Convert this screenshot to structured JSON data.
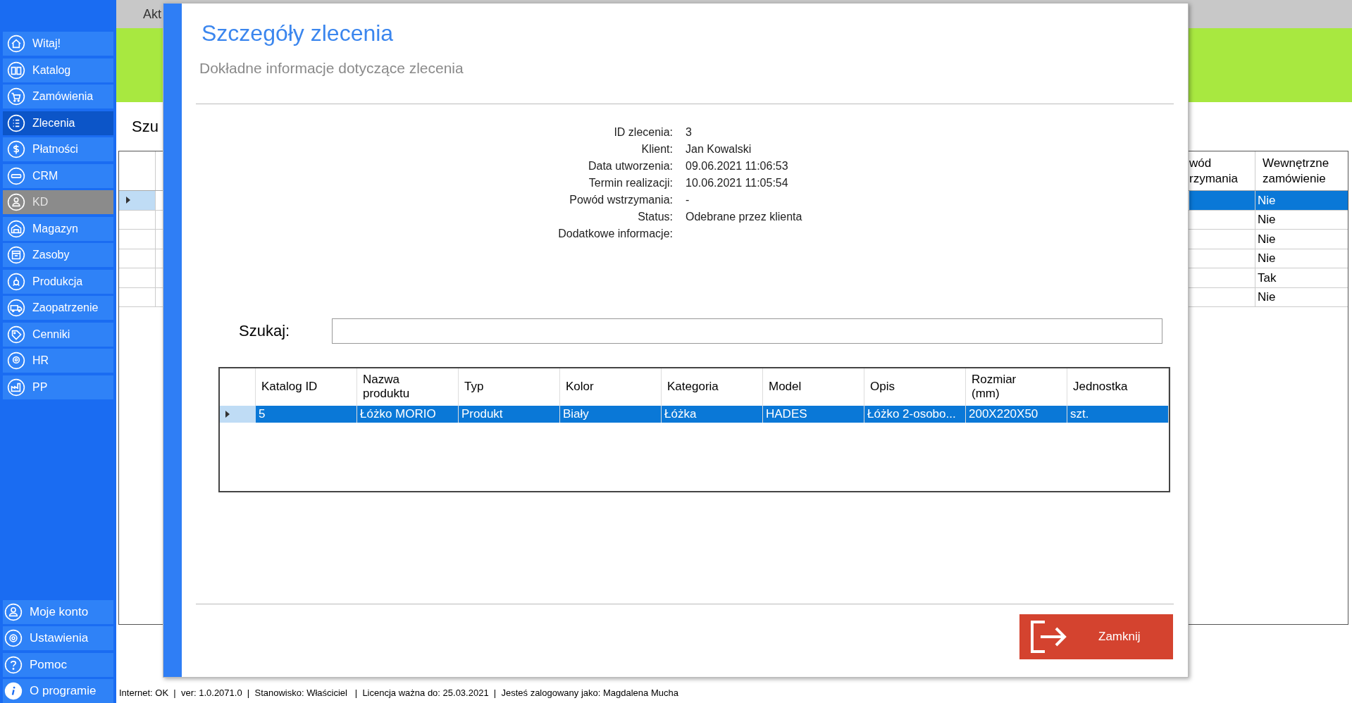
{
  "sidebar": {
    "items": [
      {
        "label": "Witaj!",
        "selected": false,
        "disabled": false
      },
      {
        "label": "Katalog",
        "selected": false,
        "disabled": false
      },
      {
        "label": "Zamówienia",
        "selected": false,
        "disabled": false
      },
      {
        "label": "Zlecenia",
        "selected": true,
        "disabled": false
      },
      {
        "label": "Płatności",
        "selected": false,
        "disabled": false
      },
      {
        "label": "CRM",
        "selected": false,
        "disabled": false
      },
      {
        "label": "KD",
        "selected": false,
        "disabled": true
      },
      {
        "label": "Magazyn",
        "selected": false,
        "disabled": false
      },
      {
        "label": "Zasoby",
        "selected": false,
        "disabled": false
      },
      {
        "label": "Produkcja",
        "selected": false,
        "disabled": false
      },
      {
        "label": "Zaopatrzenie",
        "selected": false,
        "disabled": false
      },
      {
        "label": "Cenniki",
        "selected": false,
        "disabled": false
      },
      {
        "label": "HR",
        "selected": false,
        "disabled": false
      },
      {
        "label": "PP",
        "selected": false,
        "disabled": false
      }
    ],
    "bottom_items": [
      {
        "label": "Moje konto"
      },
      {
        "label": "Ustawienia"
      },
      {
        "label": "Pomoc"
      },
      {
        "label": "O programie"
      }
    ]
  },
  "background": {
    "tab_label": "Akt",
    "search_label": "Szu",
    "table": {
      "columns": [
        "wód rzymania",
        "Wewnętrzne zamówienie"
      ],
      "rows": [
        {
          "last": "Nie",
          "selected": true
        },
        {
          "last": "Nie",
          "selected": false
        },
        {
          "last": "Nie",
          "selected": false
        },
        {
          "last": "Nie",
          "selected": false
        },
        {
          "last": "Tak",
          "selected": false
        },
        {
          "last": "Nie",
          "selected": false
        }
      ]
    }
  },
  "dialog": {
    "title": "Szczegóły zlecenia",
    "subtitle": "Dokładne informacje dotyczące zlecenia",
    "details": [
      {
        "label": "ID zlecenia:",
        "value": "3"
      },
      {
        "label": "Klient:",
        "value": "Jan Kowalski"
      },
      {
        "label": "Data utworzenia:",
        "value": "09.06.2021 11:06:53"
      },
      {
        "label": "Termin realizacji:",
        "value": "10.06.2021 11:05:54"
      },
      {
        "label": "Powód wstrzymania:",
        "value": "-"
      },
      {
        "label": "Status:",
        "value": "Odebrane przez klienta"
      },
      {
        "label": "Dodatkowe informacje:"
      }
    ],
    "search_label": "Szukaj:",
    "table": {
      "columns": [
        "Katalog ID",
        "Nazwa produktu",
        "Typ",
        "Kolor",
        "Kategoria",
        "Model",
        "Opis",
        "Rozmiar (mm)",
        "Jednostka"
      ],
      "rows": [
        {
          "cells": [
            "5",
            "Łóżko MORIO",
            "Produkt",
            "Biały",
            "Łóżka",
            "HADES",
            "Łóżko 2-osobo...",
            "200X220X50",
            "szt."
          ],
          "selected": true
        }
      ]
    },
    "close_button": "Zamknij"
  },
  "status_bar": "Internet: OK  |  ver: 1.0.2071.0  |  Stanowisko: Właściciel   |  Licencja ważna do: 25.03.2021  |  Jesteś zalogowany jako: Magdalena Mucha"
}
